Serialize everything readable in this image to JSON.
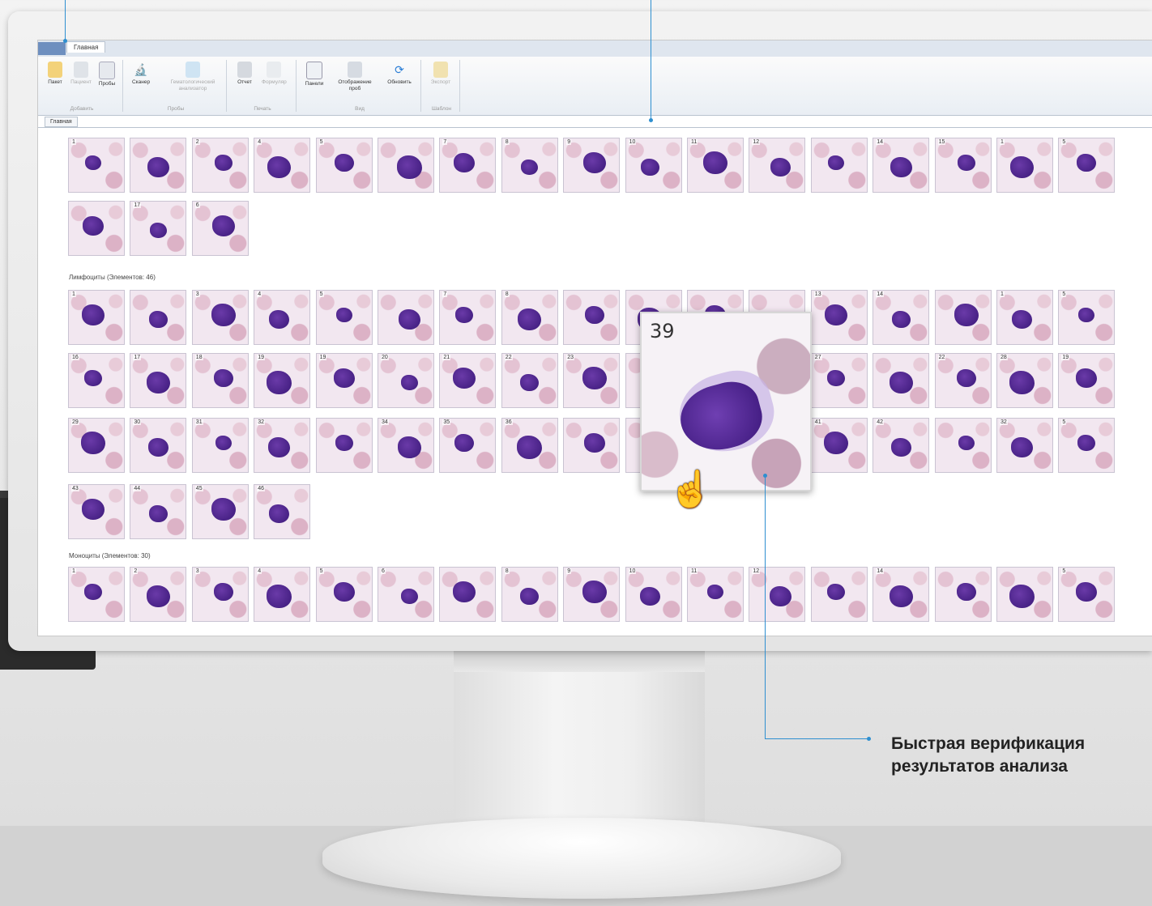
{
  "ribbon": {
    "tab_label": "Главная",
    "doc_tab_label": "Главная",
    "groups": [
      {
        "label": "Добавить",
        "buttons": [
          "Пакет",
          "Пациент",
          "Пробы"
        ]
      },
      {
        "label": "Пробы",
        "buttons": [
          "Сканер",
          "Гематологический анализатор"
        ]
      },
      {
        "label": "Печать",
        "buttons": [
          "Отчет",
          "Формуляр"
        ]
      },
      {
        "label": "Вид",
        "buttons": [
          "Панели",
          "Отображение проб",
          "Обновить"
        ]
      },
      {
        "label": "Шаблон",
        "buttons": [
          "Экспорт"
        ]
      }
    ]
  },
  "sections": {
    "lymphocytes_label": "Лимфоциты (Элементов: 46)",
    "monocytes_label": "Моноциты (Элементов: 30)"
  },
  "tiles": {
    "row1": [
      "1",
      "",
      "2",
      "4",
      "5",
      "",
      "7",
      "8",
      "9",
      "10",
      "11",
      "12",
      "",
      "14",
      "15",
      "1",
      "5"
    ],
    "row2": [
      "",
      "17",
      "6"
    ],
    "lymph_row1": [
      "1",
      "",
      "3",
      "4",
      "5",
      "",
      "7",
      "8",
      "",
      "",
      "",
      "",
      "13",
      "14",
      "",
      "1",
      "5"
    ],
    "lymph_row2": [
      "16",
      "17",
      "18",
      "19",
      "19",
      "20",
      "21",
      "22",
      "23",
      "",
      "",
      "",
      "27",
      "",
      "22",
      "28",
      "19"
    ],
    "lymph_row3": [
      "29",
      "30",
      "31",
      "32",
      "",
      "34",
      "35",
      "36",
      "",
      "",
      "",
      "",
      "41",
      "42",
      "",
      "32",
      "5"
    ],
    "lymph_row4": [
      "43",
      "44",
      "45",
      "46"
    ],
    "mono_row1": [
      "1",
      "2",
      "3",
      "4",
      "5",
      "6",
      "",
      "8",
      "9",
      "10",
      "11",
      "12",
      "",
      "14",
      "",
      "",
      "5"
    ]
  },
  "zoom": {
    "number": "39"
  },
  "callout": {
    "line1": "Быстрая верификация",
    "line2": "результатов анализа"
  },
  "colors": {
    "accent": "#2e8fd0",
    "nucleus": "#4a2590",
    "cell_bg": "#f2e7f0"
  }
}
